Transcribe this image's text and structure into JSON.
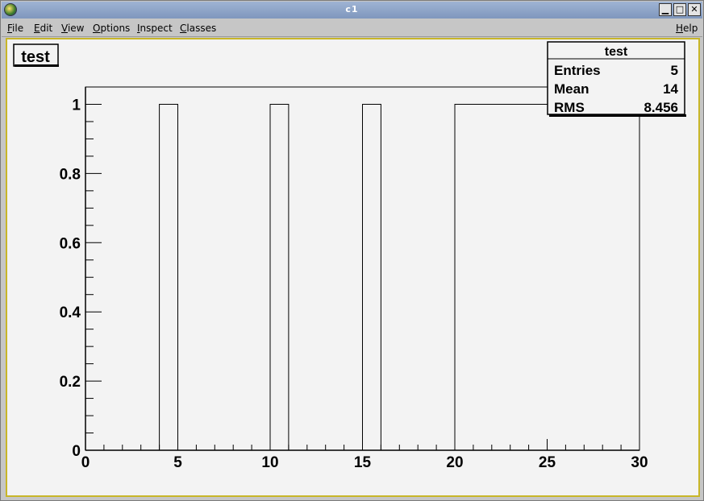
{
  "window": {
    "title": "c1",
    "buttons": {
      "minimize": "▁",
      "maximize": "□",
      "close": "✕"
    }
  },
  "menubar": {
    "items": [
      {
        "label": "File",
        "accel": "F",
        "rest": "ile"
      },
      {
        "label": "Edit",
        "accel": "E",
        "rest": "dit"
      },
      {
        "label": "View",
        "accel": "V",
        "rest": "iew"
      },
      {
        "label": "Options",
        "accel": "O",
        "rest": "ptions"
      },
      {
        "label": "Inspect",
        "accel": "I",
        "rest": "nspect"
      },
      {
        "label": "Classes",
        "accel": "C",
        "rest": "lasses"
      }
    ],
    "help": {
      "label": "Help",
      "accel": "H",
      "rest": "elp"
    }
  },
  "histogram_title": "test",
  "stats": {
    "title": "test",
    "rows": [
      {
        "label": "Entries",
        "value": "5"
      },
      {
        "label": "Mean",
        "value": "14"
      },
      {
        "label": "RMS",
        "value": "8.456"
      }
    ]
  },
  "chart_data": {
    "type": "bar",
    "title": "test",
    "xlim": [
      0,
      30
    ],
    "ylim": [
      0,
      1.05
    ],
    "x_ticks": [
      "0",
      "5",
      "10",
      "15",
      "20",
      "25",
      "30"
    ],
    "y_ticks": [
      "0",
      "0.2",
      "0.4",
      "0.6",
      "0.8",
      "1"
    ],
    "bins": [
      {
        "x0": 4,
        "x1": 5,
        "value": 1
      },
      {
        "x0": 10,
        "x1": 11,
        "value": 1
      },
      {
        "x0": 15,
        "x1": 16,
        "value": 1
      },
      {
        "x0": 20,
        "x1": 30,
        "value": 1
      }
    ],
    "grid": false,
    "legend": "top-right"
  }
}
